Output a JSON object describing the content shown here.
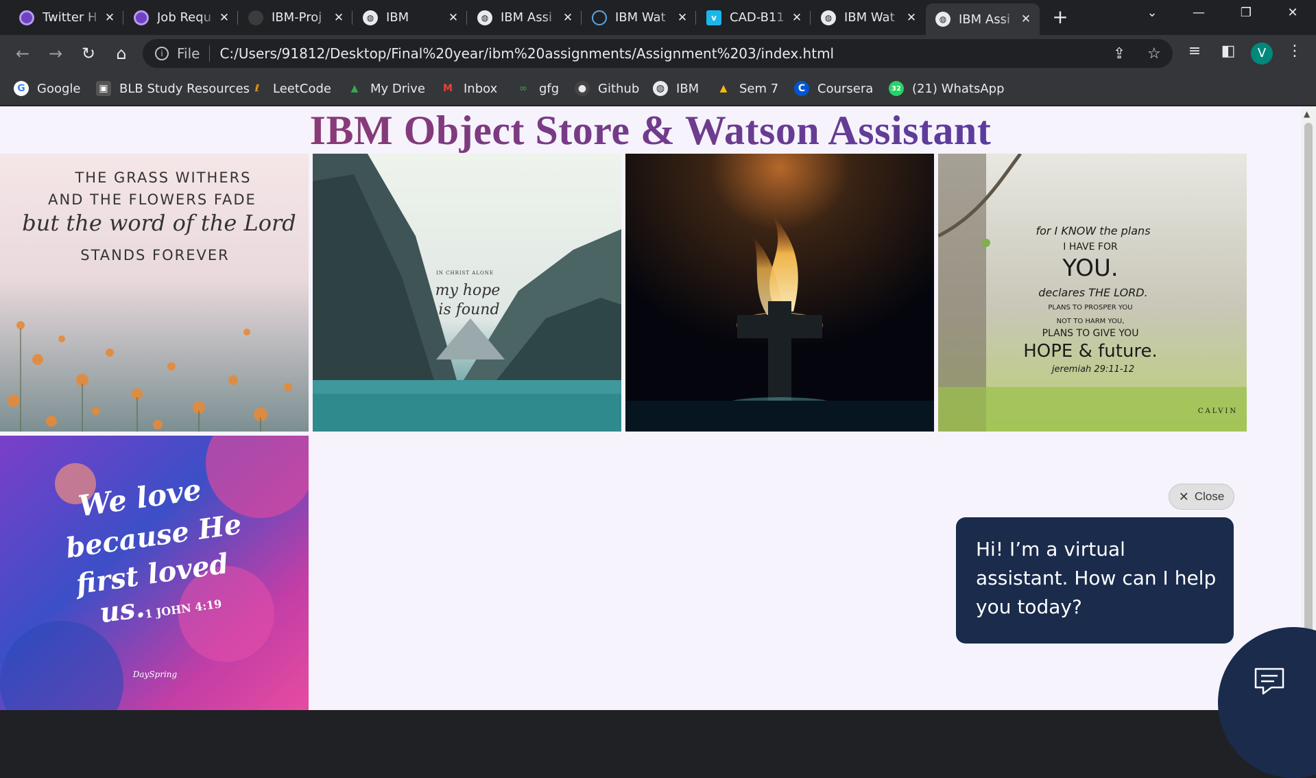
{
  "tabs": [
    {
      "title": "Twitter H",
      "favicon": "purple-app-icon"
    },
    {
      "title": "Job Requ",
      "favicon": "purple-app-icon"
    },
    {
      "title": "IBM-Proj",
      "favicon": "github-icon"
    },
    {
      "title": "IBM",
      "favicon": "globe-icon"
    },
    {
      "title": "IBM Assi",
      "favicon": "globe-icon"
    },
    {
      "title": "IBM Wat",
      "favicon": "cloud-icon"
    },
    {
      "title": "CAD-B11",
      "favicon": "vimeo-icon"
    },
    {
      "title": "IBM Wat",
      "favicon": "globe-icon"
    },
    {
      "title": "IBM Assi",
      "favicon": "globe-icon",
      "active": true
    }
  ],
  "address_bar": {
    "scheme": "File",
    "url": "C:/Users/91812/Desktop/Final%20year/ibm%20assignments/Assignment%203/index.html"
  },
  "profile_initial": "V",
  "bookmarks": [
    {
      "label": "Google",
      "icon": "google-icon"
    },
    {
      "label": "BLB Study Resources",
      "icon": "blb-icon"
    },
    {
      "label": "LeetCode",
      "icon": "leetcode-icon"
    },
    {
      "label": "My Drive",
      "icon": "drive-icon"
    },
    {
      "label": "Inbox",
      "icon": "gmail-icon"
    },
    {
      "label": "gfg",
      "icon": "gfg-icon"
    },
    {
      "label": "Github",
      "icon": "github-icon"
    },
    {
      "label": "IBM",
      "icon": "globe-icon"
    },
    {
      "label": "Sem 7",
      "icon": "drive-icon"
    },
    {
      "label": "Coursera",
      "icon": "coursera-icon"
    },
    {
      "label": "(21) WhatsApp",
      "icon": "whatsapp-icon",
      "badge": "32"
    }
  ],
  "page": {
    "heading": "IBM Object Store & Watson Assistant",
    "images": [
      {
        "name": "grass-withers-image",
        "lines": [
          "THE GRASS WITHERS",
          "AND THE FLOWERS FADE",
          "but the word of the Lord",
          "STANDS FOREVER"
        ]
      },
      {
        "name": "my-hope-mountain-image",
        "lines": [
          "IN CHRIST ALONE",
          "my hope",
          "is found"
        ]
      },
      {
        "name": "burning-cross-image",
        "lines": []
      },
      {
        "name": "know-the-plans-image",
        "lines": [
          "for I KNOW the plans",
          "I HAVE FOR",
          "YOU.",
          "declares THE LORD.",
          "PLANS TO PROSPER YOU",
          "NOT TO HARM YOU,",
          "PLANS TO GIVE YOU",
          "HOPE & future.",
          "jeremiah 29:11-12",
          "CALVIN"
        ]
      },
      {
        "name": "we-love-watercolor-image",
        "lines": [
          "We love",
          "because He",
          "first loved",
          "us.",
          "1 JOHN 4:19",
          "DaySpring"
        ]
      }
    ]
  },
  "chat": {
    "close_label": "Close",
    "greeting": "Hi! I’m a virtual assistant. How can I help you today?"
  },
  "colors": {
    "chat_bg": "#1a2b4c",
    "page_bg": "#f6f3fc",
    "heading": "#7a3c8e"
  }
}
